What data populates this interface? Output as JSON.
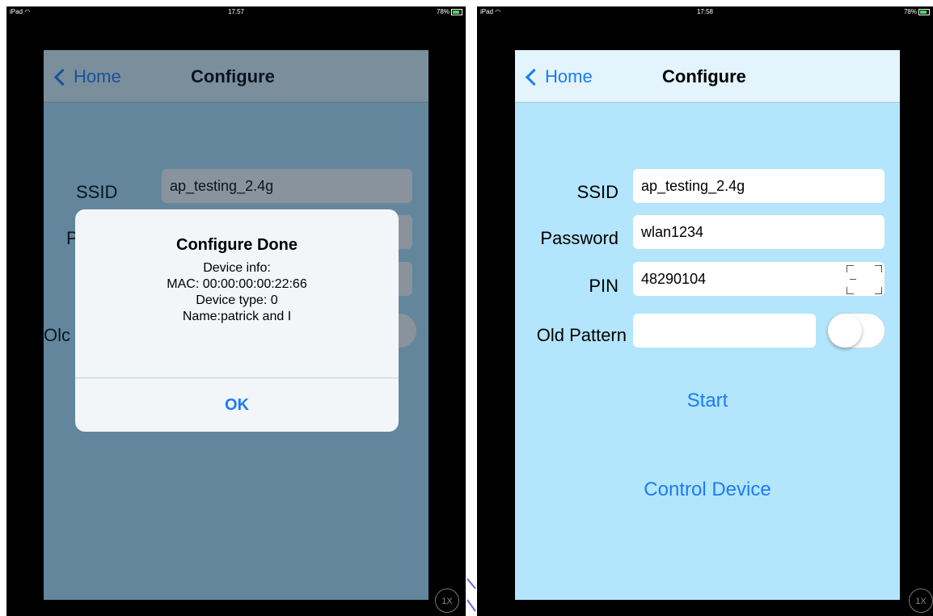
{
  "left": {
    "status": {
      "carrier": "iPad",
      "time": "17:57",
      "battery": "78%"
    },
    "nav": {
      "back_label": "Home",
      "title": "Configure"
    },
    "form": {
      "ssid_label": "SSID",
      "ssid_value": "ap_testing_2.4g",
      "password_label_partial": "Pa",
      "old_pattern_label_partial": "Olc"
    },
    "alert": {
      "title": "Configure Done",
      "lines": [
        "Device info:",
        "MAC: 00:00:00:00:22:66",
        "Device type: 0",
        "Name:patrick and I"
      ],
      "ok_label": "OK"
    },
    "zoom_label": "1X"
  },
  "right": {
    "status": {
      "carrier": "iPad",
      "time": "17:58",
      "battery": "78%"
    },
    "nav": {
      "back_label": "Home",
      "title": "Configure"
    },
    "form": {
      "ssid_label": "SSID",
      "ssid_value": "ap_testing_2.4g",
      "password_label": "Password",
      "password_value": "wlan1234",
      "pin_label": "PIN",
      "pin_value": "48290104",
      "old_pattern_label": "Old Pattern",
      "old_pattern_value": "",
      "old_pattern_toggle_on": false
    },
    "start_label": "Start",
    "control_device_label": "Control Device",
    "zoom_label": "1X"
  },
  "colors": {
    "accent": "#1a7cf5",
    "screen_bg": "#b3e5fc",
    "nav_bg": "#e3f4fc"
  }
}
